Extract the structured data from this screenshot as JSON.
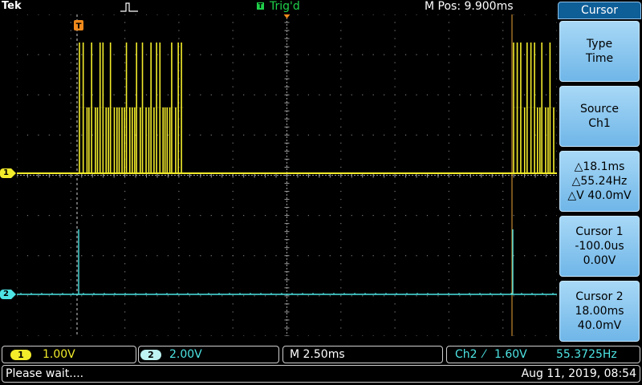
{
  "brand": "Tek",
  "trigger": {
    "badge": "T",
    "status": "Trig'd"
  },
  "m_pos": "M Pos: 9.900ms",
  "channels": [
    {
      "label": "1",
      "color": "#f3ec2b"
    },
    {
      "label": "2",
      "color": "#4ee4e4"
    }
  ],
  "cursor_marker": "T",
  "menu": {
    "title": "Cursor",
    "buttons": [
      {
        "line1": "Type",
        "line2": "Time",
        "line3": ""
      },
      {
        "line1": "Source",
        "line2": "Ch1",
        "line3": ""
      },
      {
        "line1": "△18.1ms",
        "line2": "△55.24Hz",
        "line3": "△V 40.0mV"
      },
      {
        "line1": "Cursor 1",
        "line2": "-100.0us",
        "line3": "0.00V"
      },
      {
        "line1": "Cursor 2",
        "line2": "18.00ms",
        "line3": "40.0mV"
      }
    ]
  },
  "status": {
    "ch1_label": "1",
    "ch1_scale": "1.00V",
    "ch2_label": "2",
    "ch2_scale": "2.00V",
    "timebase": "M 2.50ms",
    "trigger_source": "Ch2",
    "trigger_slope": "⁄",
    "trigger_level": "1.60V",
    "frequency": "55.3725Hz",
    "message": "Please wait....",
    "datetime": "Aug 11, 2019, 08:54"
  }
}
